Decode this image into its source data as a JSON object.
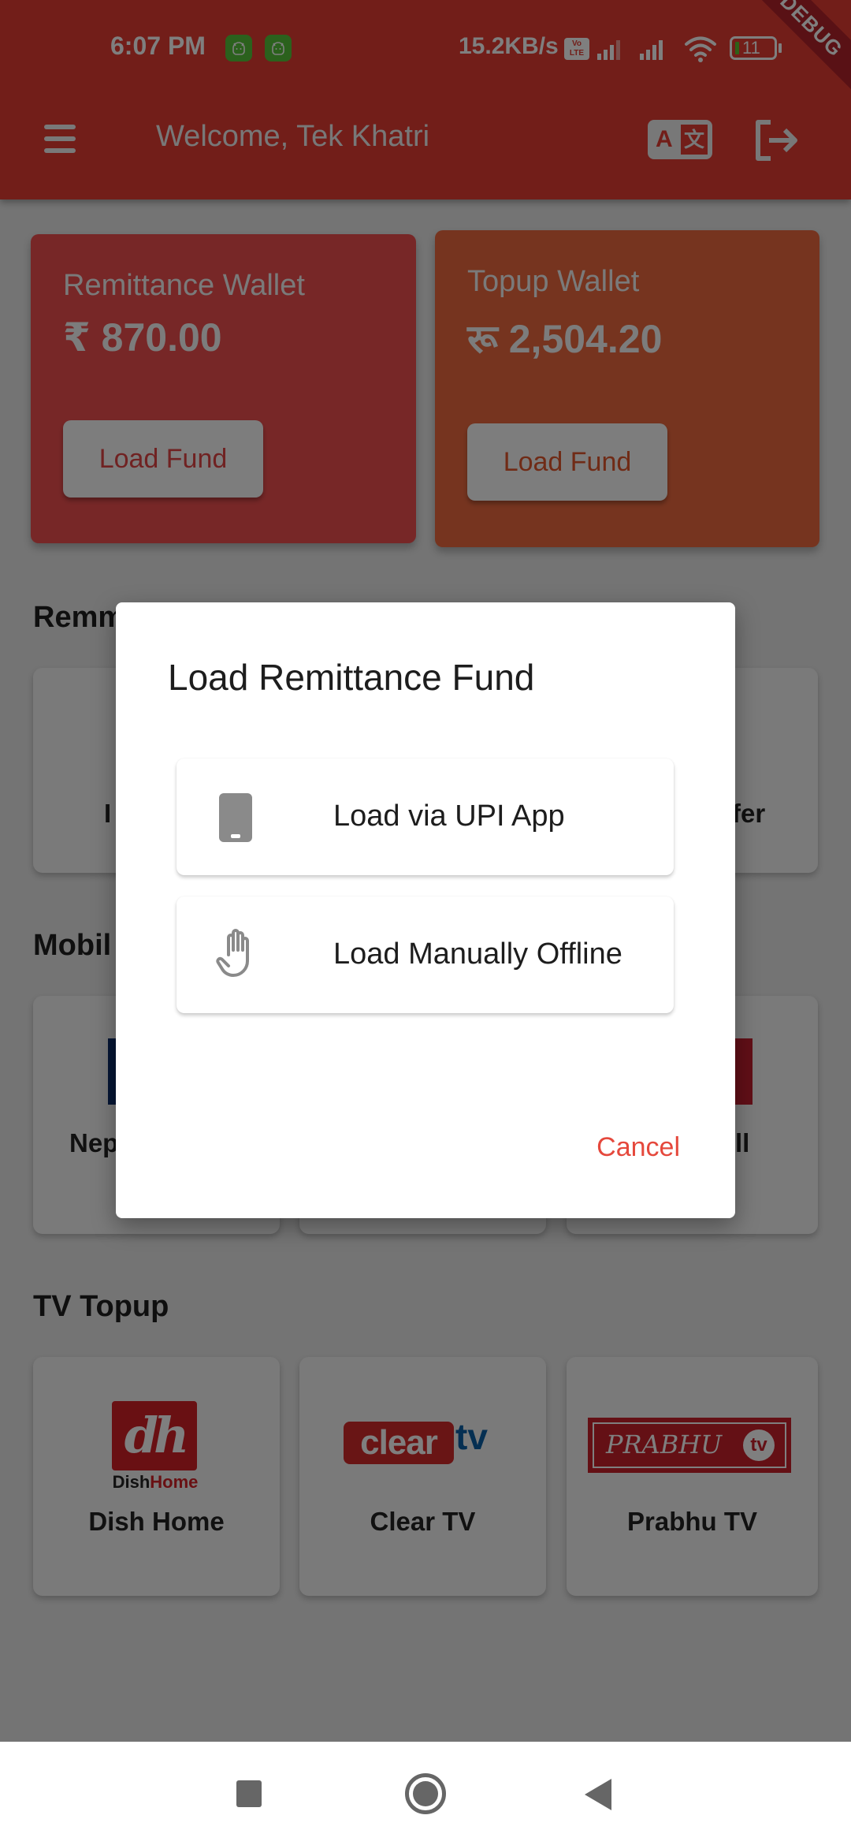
{
  "status_bar": {
    "time": "6:07 PM",
    "network_speed": "15.2KB/s",
    "volte_label": "Vo LTE",
    "battery_level": "11",
    "notification_icons": [
      "android-app-icon",
      "android-app-icon"
    ]
  },
  "debug_ribbon": "DEBUG",
  "app_bar": {
    "title": "Welcome, Tek Khatri",
    "translate_icon_letters": [
      "A",
      "文"
    ]
  },
  "wallets": [
    {
      "label": "Remittance Wallet",
      "amount": "₹ 870.00",
      "button": "Load Fund"
    },
    {
      "label": "Topup Wallet",
      "amount": "रू 2,504.20",
      "button": "Load Fund"
    }
  ],
  "sections": {
    "remittance": {
      "title_visible": "Remm",
      "items_visible": [
        "I",
        "",
        "fer"
      ]
    },
    "mobile": {
      "title_visible": "Mobil",
      "items_visible": [
        "Nep",
        "",
        "ll"
      ]
    },
    "tv": {
      "title": "TV Topup",
      "items": [
        {
          "label": "Dish Home",
          "logo_text_a": "Dish",
          "logo_text_b": "Home",
          "logo_mark": "dh"
        },
        {
          "label": "Clear TV",
          "logo_text_a": "clear",
          "logo_text_b": "tv"
        },
        {
          "label": "Prabhu TV",
          "logo_text_a": "PRABHU",
          "logo_text_b": "tv"
        }
      ]
    }
  },
  "dialog": {
    "title": "Load Remittance Fund",
    "options": [
      {
        "label": "Load via UPI App",
        "icon": "smartphone-icon"
      },
      {
        "label": "Load Manually Offline",
        "icon": "hand-icon"
      }
    ],
    "cancel_label": "Cancel"
  },
  "colors": {
    "primary": "#e43c33",
    "remittance_wallet": "#ee4f4f",
    "topup_wallet": "#ec693f",
    "cancel_text": "#e5483c"
  }
}
